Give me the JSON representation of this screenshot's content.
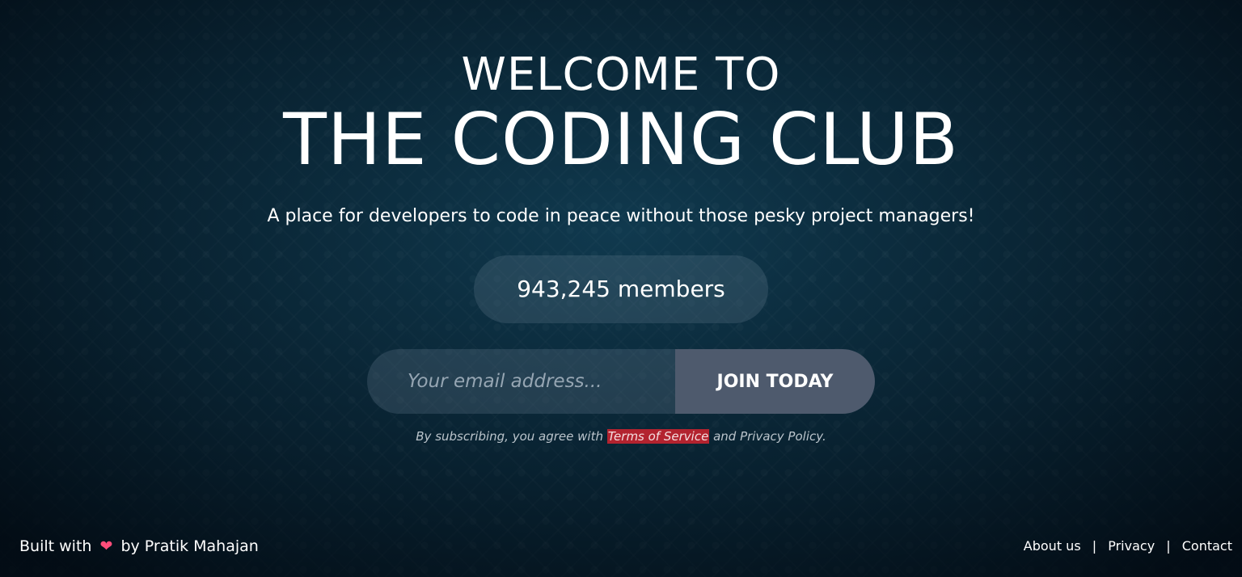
{
  "hero": {
    "welcome": "WELCOME TO",
    "title": "THE CODING CLUB",
    "tagline": "A place for developers to code in peace without those pesky project managers!",
    "members": "943,245 members"
  },
  "signup": {
    "email_placeholder": "Your email address...",
    "email_value": "",
    "join_label": "JOIN TODAY"
  },
  "terms": {
    "prefix": "By subscribing, you agree with",
    "tos_link": "Terms of Service",
    "suffix": "and Privacy Policy."
  },
  "footer": {
    "built_prefix": "Built with",
    "heart_icon": "heart-icon",
    "built_suffix": "by Pratik Mahajan",
    "links": [
      "About us",
      "Privacy",
      "Contact"
    ],
    "separator": "|"
  },
  "colors": {
    "background": "#0b2a3a",
    "join_button": "#4e5a6d",
    "tos_highlight": "#b3232f",
    "heart": "#ff4d7a"
  }
}
